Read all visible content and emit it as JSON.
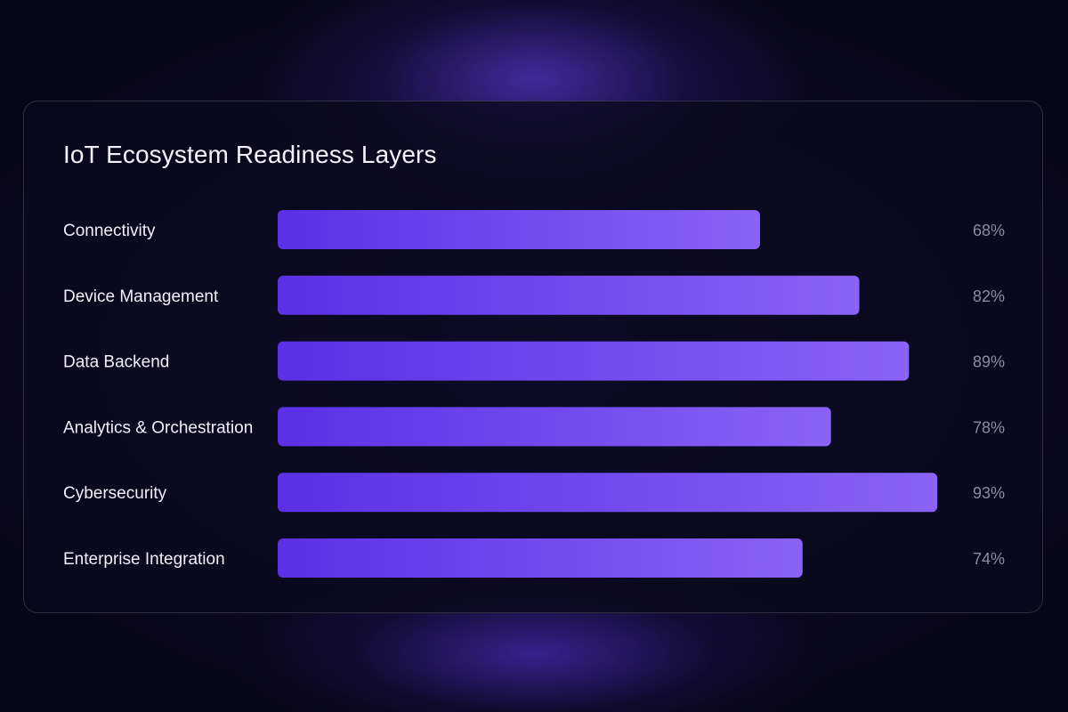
{
  "chart_data": {
    "type": "bar",
    "orientation": "horizontal",
    "title": "IoT Ecosystem Readiness Layers",
    "categories": [
      "Connectivity",
      "Device Management",
      "Data Backend",
      "Analytics & Orchestration",
      "Cybersecurity",
      "Enterprise Integration"
    ],
    "values": [
      68,
      82,
      89,
      78,
      93,
      74
    ],
    "value_labels": [
      "68%",
      "82%",
      "89%",
      "78%",
      "93%",
      "74%"
    ],
    "unit": "%",
    "xlim": [
      0,
      100
    ],
    "grid": false,
    "legend": "none",
    "colors": {
      "bar_start": "#5b30e6",
      "bar_end": "#8a63f7",
      "label": "#f1f0f8",
      "value": "#8d8b9e"
    }
  }
}
